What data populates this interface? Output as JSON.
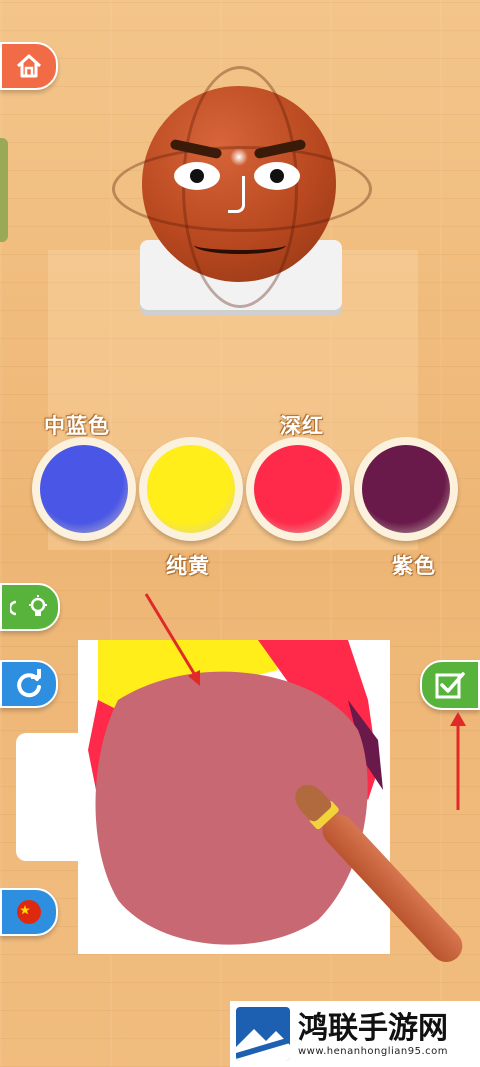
{
  "colors": {
    "blue": "#4a56e6",
    "yellow": "#ffee1a",
    "red": "#ff2a4a",
    "purple": "#6a1a4a",
    "mixed": "#c86872"
  },
  "labels": {
    "blue": "中蓝色",
    "yellow": "纯黄",
    "red": "深红",
    "purple": "紫色"
  },
  "icons": {
    "home": "home-icon",
    "hint": "lightbulb-icon",
    "rotate": "rotate-icon",
    "flag": "china-flag-icon",
    "done": "checkbox-icon"
  },
  "watermark": {
    "title": "鸿联手游网",
    "url": "www.henanhonglian95.com"
  }
}
